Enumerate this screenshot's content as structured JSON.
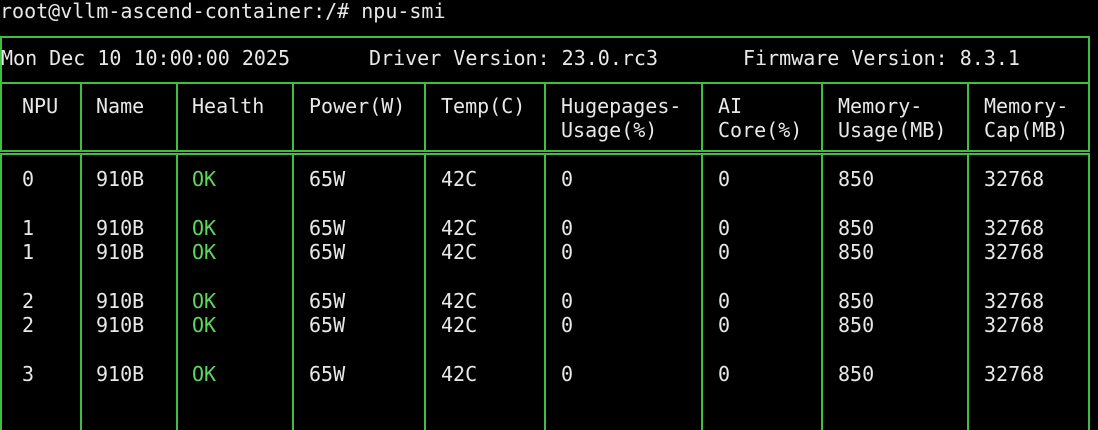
{
  "terminal": {
    "prompt_line": "root@vllm-ascend-container:/# npu-smi"
  },
  "header": {
    "timestamp": "Mon Dec 10 10:00:00 2025",
    "driver": "Driver Version: 23.0.rc3",
    "firmware": "Firmware Version: 8.3.1"
  },
  "columns": [
    {
      "line1": "NPU",
      "line2": ""
    },
    {
      "line1": "Name",
      "line2": ""
    },
    {
      "line1": "Health",
      "line2": ""
    },
    {
      "line1": "Power(W)",
      "line2": ""
    },
    {
      "line1": "Temp(C)",
      "line2": ""
    },
    {
      "line1": "Hugepages-",
      "line2": "Usage(%)"
    },
    {
      "line1": "AI",
      "line2": "Core(%)"
    },
    {
      "line1": "Memory-",
      "line2": "Usage(MB)"
    },
    {
      "line1": "Memory-",
      "line2": "Cap(MB)"
    }
  ],
  "rows": [
    [
      "0",
      "910B",
      "OK",
      "65W",
      "42C",
      "0",
      "0",
      "850",
      "32768"
    ],
    [
      "1",
      "910B",
      "OK",
      "65W",
      "42C",
      "0",
      "0",
      "850",
      "32768"
    ],
    [
      "1",
      "910B",
      "OK",
      "65W",
      "42C",
      "0",
      "0",
      "850",
      "32768"
    ],
    [
      "2",
      "910B",
      "OK",
      "65W",
      "42C",
      "0",
      "0",
      "850",
      "32768"
    ],
    [
      "2",
      "910B",
      "OK",
      "65W",
      "42C",
      "0",
      "0",
      "850",
      "32768"
    ],
    [
      "3",
      "910B",
      "OK",
      "65W",
      "42C",
      "0",
      "0",
      "850",
      "32768"
    ]
  ],
  "colors": {
    "background": "#000000",
    "text": "#e8e8e8",
    "border": "#3ec03e",
    "health_ok": "#5fd75f"
  }
}
